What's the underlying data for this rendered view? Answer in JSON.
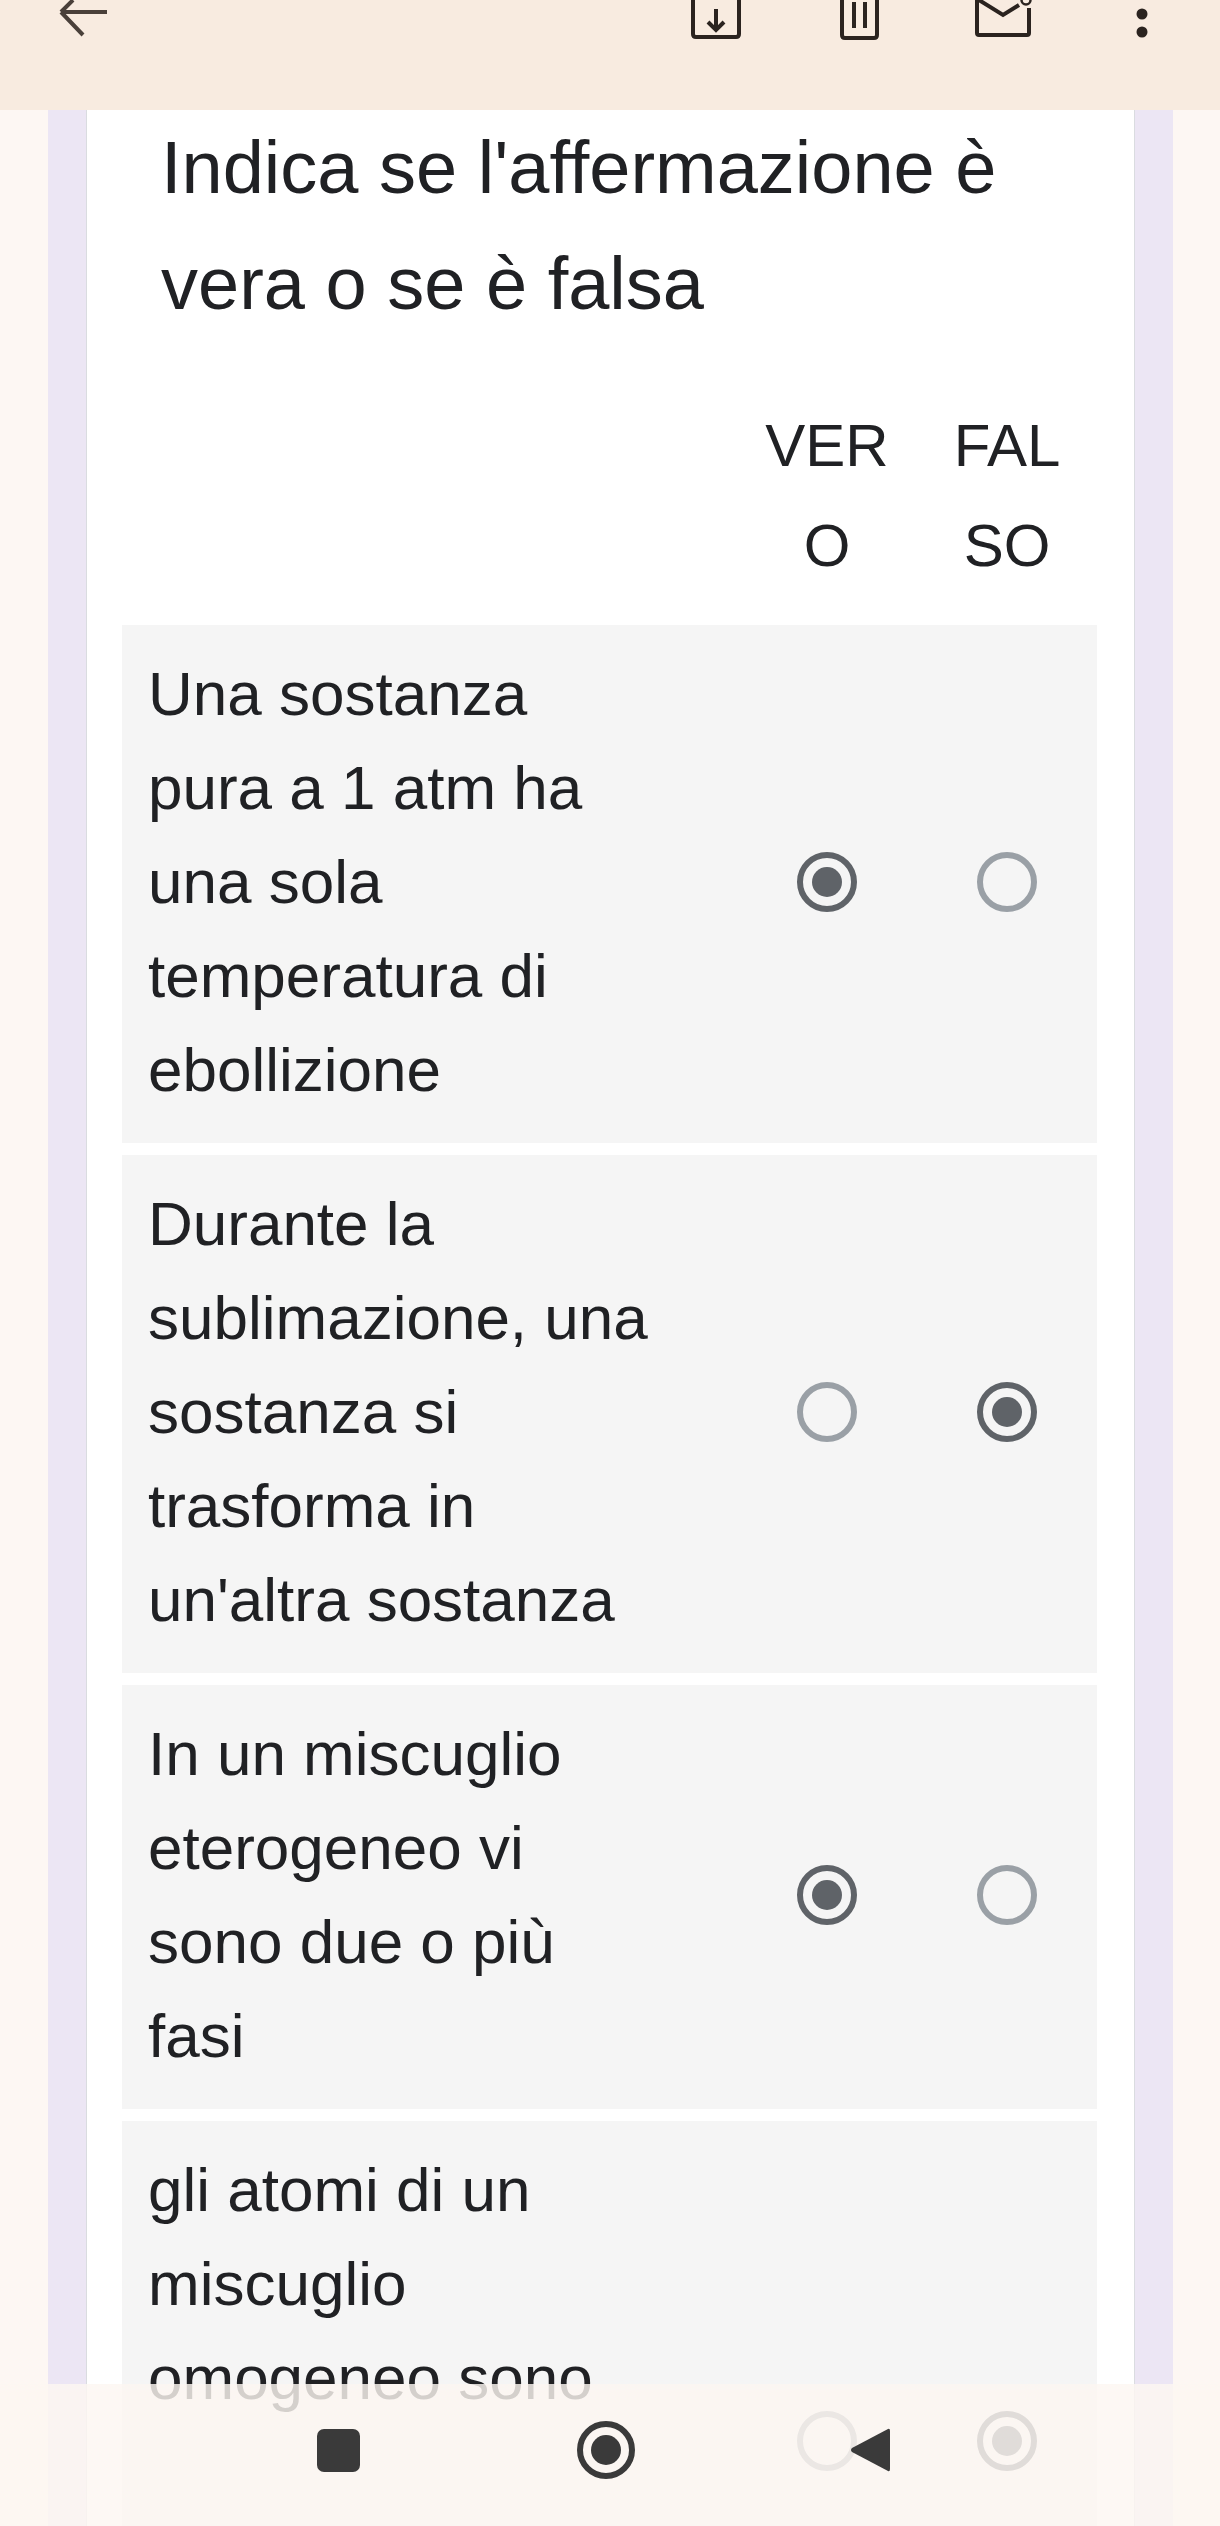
{
  "question": {
    "title": "Indica se l'affermazione è vera o se è falsa",
    "columns": [
      "VERO",
      "FALSO"
    ],
    "rows": [
      {
        "text": "Una sostanza pura a 1 atm ha una sola temperatura di ebollizione",
        "options": [
          {
            "selected": true
          },
          {
            "selected": false
          }
        ]
      },
      {
        "text": "Durante la sublimazione, una sostanza si trasforma in un'altra sostanza",
        "options": [
          {
            "selected": false
          },
          {
            "selected": true
          }
        ]
      },
      {
        "text": "In un miscuglio eterogeneo vi sono due o più fasi",
        "options": [
          {
            "selected": true
          },
          {
            "selected": false
          }
        ]
      },
      {
        "text": "gli atomi di un miscuglio omogeneo sono",
        "options": [
          {
            "selected": false
          },
          {
            "selected": true
          }
        ]
      }
    ]
  }
}
